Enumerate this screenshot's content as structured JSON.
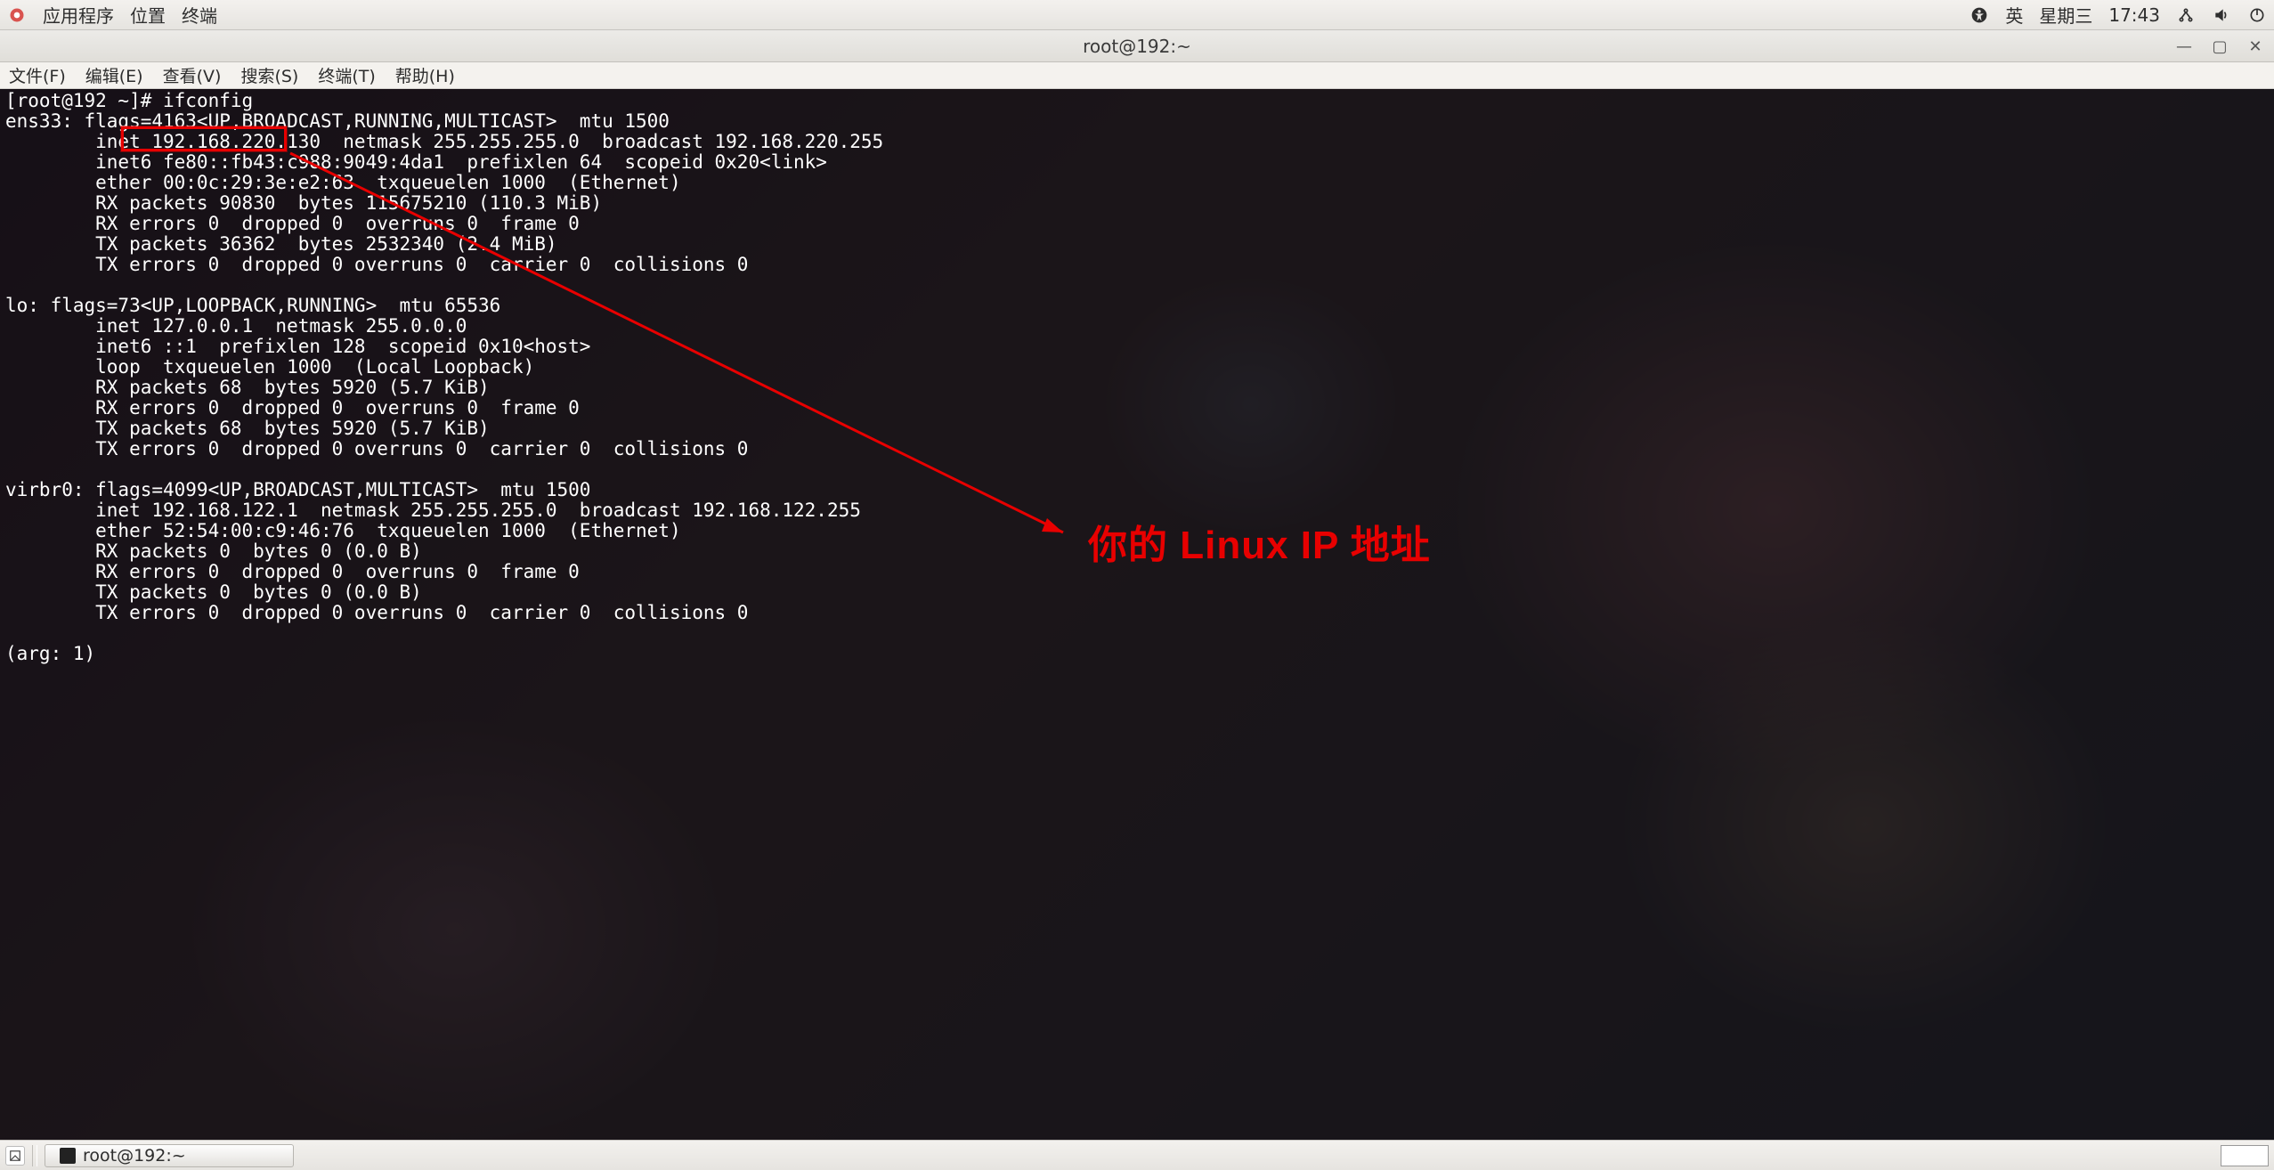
{
  "topbar": {
    "apps": "应用程序",
    "places": "位置",
    "terminal": "终端",
    "ime": "英",
    "day": "星期三",
    "time": "17:43"
  },
  "window": {
    "title": "root@192:~"
  },
  "menubar": {
    "file": "文件(F)",
    "edit": "编辑(E)",
    "view": "查看(V)",
    "search": "搜索(S)",
    "term": "终端(T)",
    "help": "帮助(H)"
  },
  "terminal": {
    "prompt": "[root@192 ~]# ",
    "cmd": "ifconfig",
    "lines": {
      "l01": "ens33: flags=4163<UP,BROADCAST,RUNNING,MULTICAST>  mtu 1500",
      "l02": "        inet 192.168.220.130  netmask 255.255.255.0  broadcast 192.168.220.255",
      "l03": "        inet6 fe80::fb43:c988:9049:4da1  prefixlen 64  scopeid 0x20<link>",
      "l04": "        ether 00:0c:29:3e:e2:63  txqueuelen 1000  (Ethernet)",
      "l05": "        RX packets 90830  bytes 115675210 (110.3 MiB)",
      "l06": "        RX errors 0  dropped 0  overruns 0  frame 0",
      "l07": "        TX packets 36362  bytes 2532340 (2.4 MiB)",
      "l08": "        TX errors 0  dropped 0 overruns 0  carrier 0  collisions 0",
      "l09": "",
      "l10": "lo: flags=73<UP,LOOPBACK,RUNNING>  mtu 65536",
      "l11": "        inet 127.0.0.1  netmask 255.0.0.0",
      "l12": "        inet6 ::1  prefixlen 128  scopeid 0x10<host>",
      "l13": "        loop  txqueuelen 1000  (Local Loopback)",
      "l14": "        RX packets 68  bytes 5920 (5.7 KiB)",
      "l15": "        RX errors 0  dropped 0  overruns 0  frame 0",
      "l16": "        TX packets 68  bytes 5920 (5.7 KiB)",
      "l17": "        TX errors 0  dropped 0 overruns 0  carrier 0  collisions 0",
      "l18": "",
      "l19": "virbr0: flags=4099<UP,BROADCAST,MULTICAST>  mtu 1500",
      "l20": "        inet 192.168.122.1  netmask 255.255.255.0  broadcast 192.168.122.255",
      "l21": "        ether 52:54:00:c9:46:76  txqueuelen 1000  (Ethernet)",
      "l22": "        RX packets 0  bytes 0 (0.0 B)",
      "l23": "        RX errors 0  dropped 0  overruns 0  frame 0",
      "l24": "        TX packets 0  bytes 0 (0.0 B)",
      "l25": "        TX errors 0  dropped 0 overruns 0  carrier 0  collisions 0",
      "l26": "",
      "l27": "(arg: 1)"
    },
    "highlight_ip": "192.168.220.130"
  },
  "annotation": {
    "label": "你的 Linux IP 地址"
  },
  "taskbar": {
    "task_label": "root@192:~"
  }
}
